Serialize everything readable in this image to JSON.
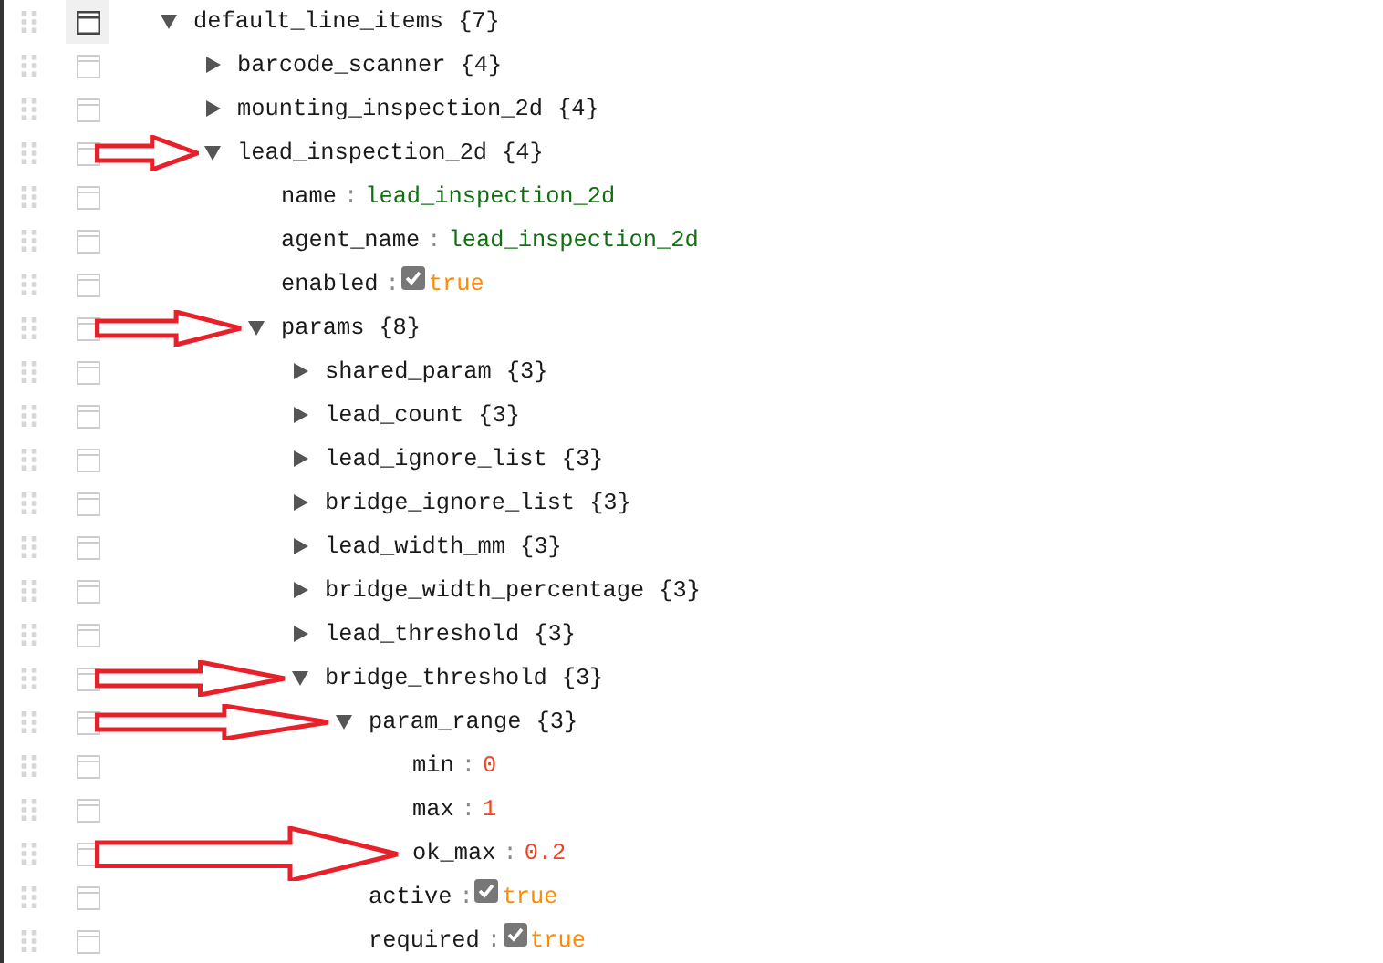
{
  "tree": [
    {
      "kind": "object",
      "key": "default_line_items",
      "count": "{7}",
      "expanded": true,
      "selected": true,
      "annotated": false,
      "children": [
        {
          "kind": "object",
          "key": "barcode_scanner",
          "count": "{4}",
          "expanded": false,
          "selected": false,
          "annotated": false
        },
        {
          "kind": "object",
          "key": "mounting_inspection_2d",
          "count": "{4}",
          "expanded": false,
          "selected": false,
          "annotated": false
        },
        {
          "kind": "object",
          "key": "lead_inspection_2d",
          "count": "{4}",
          "expanded": true,
          "selected": false,
          "annotated": true,
          "children": [
            {
              "kind": "string",
              "key": "name",
              "separator": ":",
              "value": "lead_inspection_2d",
              "selected": false,
              "annotated": false
            },
            {
              "kind": "string",
              "key": "agent_name",
              "separator": ":",
              "value": "lead_inspection_2d",
              "selected": false,
              "annotated": false
            },
            {
              "kind": "boolean",
              "key": "enabled",
              "separator": ":",
              "checked": true,
              "value": "true",
              "selected": false,
              "annotated": false
            },
            {
              "kind": "object",
              "key": "params",
              "count": "{8}",
              "expanded": true,
              "selected": false,
              "annotated": true,
              "children": [
                {
                  "kind": "object",
                  "key": "shared_param",
                  "count": "{3}",
                  "expanded": false,
                  "selected": false,
                  "annotated": false
                },
                {
                  "kind": "object",
                  "key": "lead_count",
                  "count": "{3}",
                  "expanded": false,
                  "selected": false,
                  "annotated": false
                },
                {
                  "kind": "object",
                  "key": "lead_ignore_list",
                  "count": "{3}",
                  "expanded": false,
                  "selected": false,
                  "annotated": false
                },
                {
                  "kind": "object",
                  "key": "bridge_ignore_list",
                  "count": "{3}",
                  "expanded": false,
                  "selected": false,
                  "annotated": false
                },
                {
                  "kind": "object",
                  "key": "lead_width_mm",
                  "count": "{3}",
                  "expanded": false,
                  "selected": false,
                  "annotated": false
                },
                {
                  "kind": "object",
                  "key": "bridge_width_percentage",
                  "count": "{3}",
                  "expanded": false,
                  "selected": false,
                  "annotated": false
                },
                {
                  "kind": "object",
                  "key": "lead_threshold",
                  "count": "{3}",
                  "expanded": false,
                  "selected": false,
                  "annotated": false
                },
                {
                  "kind": "object",
                  "key": "bridge_threshold",
                  "count": "{3}",
                  "expanded": true,
                  "selected": false,
                  "annotated": true,
                  "children": [
                    {
                      "kind": "object",
                      "key": "param_range",
                      "count": "{3}",
                      "expanded": true,
                      "selected": false,
                      "annotated": true,
                      "children": [
                        {
                          "kind": "number",
                          "key": "min",
                          "separator": ":",
                          "value": "0",
                          "selected": false,
                          "annotated": false
                        },
                        {
                          "kind": "number",
                          "key": "max",
                          "separator": ":",
                          "value": "1",
                          "selected": false,
                          "annotated": false
                        },
                        {
                          "kind": "number",
                          "key": "ok_max",
                          "separator": ":",
                          "value": "0.2",
                          "selected": false,
                          "annotated": true
                        }
                      ]
                    },
                    {
                      "kind": "boolean",
                      "key": "active",
                      "separator": ":",
                      "checked": true,
                      "value": "true",
                      "selected": false,
                      "annotated": false
                    },
                    {
                      "kind": "boolean",
                      "key": "required",
                      "separator": ":",
                      "checked": true,
                      "value": "true",
                      "selected": false,
                      "annotated": false
                    }
                  ]
                }
              ]
            }
          ]
        }
      ]
    }
  ]
}
